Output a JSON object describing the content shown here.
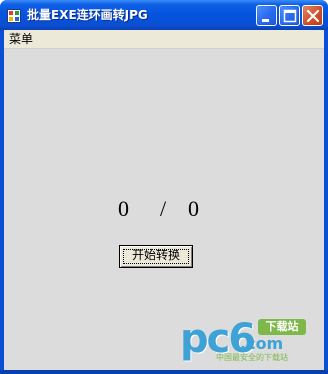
{
  "window": {
    "title": "批量EXE连环画转JPG",
    "icon": "app-icon",
    "controls": {
      "minimize_icon": "minimize-icon",
      "maximize_icon": "maximize-icon",
      "close_icon": "close-icon"
    }
  },
  "menubar": {
    "items": [
      {
        "label": "菜单"
      }
    ]
  },
  "progress": {
    "current": "0",
    "separator": "/",
    "total": "0"
  },
  "actions": {
    "start_label": "开始转换"
  },
  "watermark": {
    "logo": "pc6",
    "dotcom": ".com",
    "badge": "下载站",
    "tagline": "中国最安全的下载站"
  },
  "colors": {
    "titlebar": "#0553de",
    "client_background": "#dcdcdc",
    "menubar": "#ece9d8",
    "watermark_blue": "#3fa2d6",
    "watermark_green": "#7fb84a"
  }
}
